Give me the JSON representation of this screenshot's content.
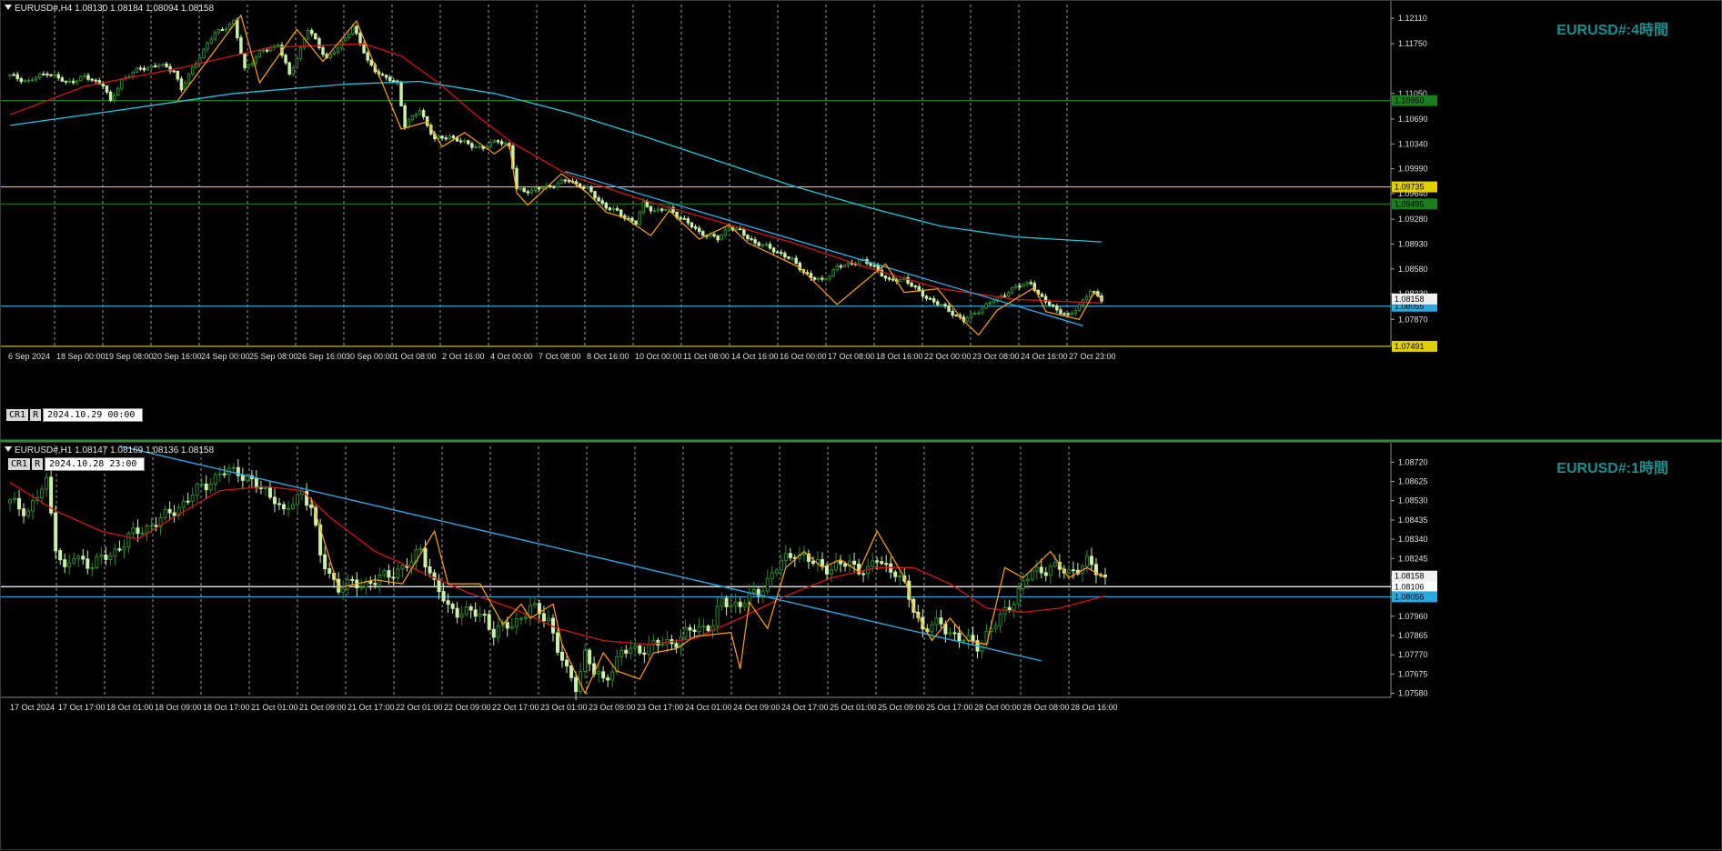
{
  "panel_h4": {
    "info": "EURUSD#,H4  1.08130 1.08184 1.08094 1.08158",
    "watermark": "EURUSD#:4時間",
    "tag1": "CR1",
    "tag2": "R",
    "timestamp": "2024.10.29 00:00"
  },
  "panel_h1": {
    "info": "EURUSD#,H1  1.08147 1.08169 1.08136 1.08158",
    "watermark": "EURUSD#:1時間",
    "tag1": "CR1",
    "tag2": "R",
    "timestamp": "2024.10.28 23:00"
  },
  "colors": {
    "bull": "#2a8a2a",
    "bull_body": "#000000",
    "bear": "#ccf0aa",
    "ma_red": "#d21414",
    "ma_cyan": "#1ec8dc",
    "zigzag": "#ffa500",
    "trend": "#2aa8e0",
    "hline_green": "#1a7f1a",
    "hline_yellow": "#e0d000",
    "hline_cyan": "#2aa8e0",
    "hline_white": "#ffffff",
    "grid": "#9a9a9a",
    "axis_text": "#e0e0e0"
  },
  "chart_data": [
    {
      "type": "candlestick",
      "title": "EURUSD#,H4",
      "ylim": [
        1.0749,
        1.1225
      ],
      "y_ticks": [
        1.1211,
        1.1175,
        1.1105,
        1.1069,
        1.1034,
        1.0999,
        1.0964,
        1.0928,
        1.0893,
        1.0858,
        1.0823,
        1.0787
      ],
      "x_labels": [
        "6 Sep 2024",
        "18 Sep 00:00",
        "19 Sep 08:00",
        "20 Sep 16:00",
        "24 Sep 00:00",
        "25 Sep 08:00",
        "26 Sep 16:00",
        "30 Sep 00:00",
        "1 Oct 08:00",
        "2 Oct 16:00",
        "4 Oct 00:00",
        "7 Oct 08:00",
        "8 Oct 16:00",
        "10 Oct 00:00",
        "11 Oct 08:00",
        "14 Oct 16:00",
        "16 Oct 00:00",
        "17 Oct 08:00",
        "18 Oct 16:00",
        "22 Oct 00:00",
        "23 Oct 08:00",
        "24 Oct 16:00",
        "27 Oct 23:00"
      ],
      "close_path": [
        [
          0,
          1.113
        ],
        [
          5,
          1.1122
        ],
        [
          10,
          1.1135
        ],
        [
          15,
          1.112
        ],
        [
          20,
          1.1128
        ],
        [
          25,
          1.1118
        ],
        [
          27,
          1.1092
        ],
        [
          30,
          1.1125
        ],
        [
          35,
          1.114
        ],
        [
          40,
          1.1145
        ],
        [
          44,
          1.1138
        ],
        [
          46,
          1.111
        ],
        [
          50,
          1.115
        ],
        [
          55,
          1.119
        ],
        [
          60,
          1.1205
        ],
        [
          63,
          1.114
        ],
        [
          67,
          1.1162
        ],
        [
          72,
          1.1175
        ],
        [
          75,
          1.113
        ],
        [
          80,
          1.1195
        ],
        [
          85,
          1.1155
        ],
        [
          88,
          1.1168
        ],
        [
          92,
          1.12
        ],
        [
          96,
          1.115
        ],
        [
          100,
          1.1128
        ],
        [
          104,
          1.112
        ],
        [
          106,
          1.106
        ],
        [
          110,
          1.1082
        ],
        [
          114,
          1.104
        ],
        [
          118,
          1.1045
        ],
        [
          122,
          1.1035
        ],
        [
          127,
          1.1028
        ],
        [
          131,
          1.104
        ],
        [
          134,
          1.103
        ],
        [
          136,
          1.097
        ],
        [
          140,
          1.0968
        ],
        [
          145,
          1.0975
        ],
        [
          150,
          1.0983
        ],
        [
          155,
          1.097
        ],
        [
          158,
          1.0955
        ],
        [
          160,
          1.0945
        ],
        [
          163,
          1.0938
        ],
        [
          168,
          1.0922
        ],
        [
          170,
          1.095
        ],
        [
          173,
          1.094
        ],
        [
          177,
          1.0942
        ],
        [
          180,
          1.093
        ],
        [
          185,
          1.091
        ],
        [
          190,
          1.09
        ],
        [
          193,
          1.0918
        ],
        [
          196,
          1.091
        ],
        [
          200,
          1.0895
        ],
        [
          205,
          1.0885
        ],
        [
          210,
          1.087
        ],
        [
          215,
          1.0845
        ],
        [
          218,
          1.0842
        ],
        [
          222,
          1.086
        ],
        [
          228,
          1.087
        ],
        [
          232,
          1.0862
        ],
        [
          236,
          1.084
        ],
        [
          240,
          1.0845
        ],
        [
          244,
          1.0825
        ],
        [
          248,
          1.0812
        ],
        [
          252,
          1.08
        ],
        [
          256,
          1.0785
        ],
        [
          260,
          1.08
        ],
        [
          266,
          1.082
        ],
        [
          270,
          1.0832
        ],
        [
          274,
          1.084
        ],
        [
          276,
          1.082
        ],
        [
          280,
          1.0805
        ],
        [
          284,
          1.079
        ],
        [
          287,
          1.0808
        ],
        [
          290,
          1.0826
        ],
        [
          293,
          1.0816
        ]
      ],
      "series": [
        {
          "kind": "ma_red",
          "points": [
            [
              0,
              1.1075
            ],
            [
              20,
              1.1115
            ],
            [
              45,
              1.114
            ],
            [
              70,
              1.117
            ],
            [
              95,
              1.1175
            ],
            [
              105,
              1.1158
            ],
            [
              115,
              1.112
            ],
            [
              125,
              1.1075
            ],
            [
              135,
              1.1035
            ],
            [
              150,
              1.099
            ],
            [
              170,
              1.0955
            ],
            [
              190,
              1.0925
            ],
            [
              210,
              1.0895
            ],
            [
              230,
              1.086
            ],
            [
              250,
              1.083
            ],
            [
              270,
              1.0815
            ],
            [
              293,
              1.081
            ]
          ]
        },
        {
          "kind": "ma_cyan",
          "points": [
            [
              0,
              1.106
            ],
            [
              30,
              1.1082
            ],
            [
              60,
              1.1105
            ],
            [
              90,
              1.1118
            ],
            [
              110,
              1.1122
            ],
            [
              130,
              1.1105
            ],
            [
              150,
              1.1078
            ],
            [
              170,
              1.1045
            ],
            [
              190,
              1.101
            ],
            [
              210,
              1.0975
            ],
            [
              230,
              1.0945
            ],
            [
              250,
              1.0918
            ],
            [
              270,
              1.0903
            ],
            [
              293,
              1.0896
            ]
          ]
        },
        {
          "kind": "trend",
          "points": [
            [
              149,
              1.0995
            ],
            [
              288,
              1.0778
            ]
          ]
        }
      ],
      "zigzag": [
        [
          45,
          1.1095
        ],
        [
          62,
          1.1215
        ],
        [
          67,
          1.112
        ],
        [
          77,
          1.1195
        ],
        [
          84,
          1.115
        ],
        [
          93,
          1.1207
        ],
        [
          105,
          1.1055
        ],
        [
          112,
          1.1065
        ],
        [
          116,
          1.103
        ],
        [
          122,
          1.105
        ],
        [
          130,
          1.102
        ],
        [
          134,
          1.1035
        ],
        [
          136,
          1.0965
        ],
        [
          139,
          1.0948
        ],
        [
          148,
          1.0992
        ],
        [
          155,
          1.0965
        ],
        [
          160,
          1.0938
        ],
        [
          165,
          1.093
        ],
        [
          172,
          1.0905
        ],
        [
          177,
          1.094
        ],
        [
          185,
          1.09
        ],
        [
          193,
          1.092
        ],
        [
          198,
          1.0895
        ],
        [
          212,
          1.086
        ],
        [
          222,
          1.0808
        ],
        [
          235,
          1.0865
        ],
        [
          240,
          1.0825
        ],
        [
          249,
          1.083
        ],
        [
          256,
          1.0785
        ],
        [
          260,
          1.0765
        ],
        [
          265,
          1.08
        ],
        [
          275,
          1.0832
        ],
        [
          278,
          1.0798
        ],
        [
          287,
          1.0787
        ],
        [
          291,
          1.0825
        ],
        [
          293,
          1.0816
        ]
      ],
      "hlines": [
        {
          "price": 1.1095,
          "label": "1.10950",
          "color": "hline_green"
        },
        {
          "price": 1.09735,
          "label": "1.09735",
          "color": "hline_yellow"
        },
        {
          "price": 1.09495,
          "label": "1.09495",
          "color": "hline_green"
        },
        {
          "price": 1.08056,
          "label": "1.08056",
          "color": "hline_cyan"
        },
        {
          "price": 1.07491,
          "label": "1.07491",
          "color": "hline_yellow"
        }
      ],
      "current_price": "1.08158"
    },
    {
      "type": "candlestick",
      "title": "EURUSD#,H1",
      "ylim": [
        1.0756,
        1.0878
      ],
      "y_ticks": [
        1.0872,
        1.08625,
        1.0853,
        1.08435,
        1.0834,
        1.08245,
        1.0815,
        1.08055,
        1.0796,
        1.07865,
        1.0777,
        1.07675,
        1.0758
      ],
      "x_labels": [
        "17 Oct 2024",
        "17 Oct 17:00",
        "18 Oct 01:00",
        "18 Oct 09:00",
        "18 Oct 17:00",
        "21 Oct 01:00",
        "21 Oct 09:00",
        "21 Oct 17:00",
        "22 Oct 01:00",
        "22 Oct 09:00",
        "22 Oct 17:00",
        "23 Oct 01:00",
        "23 Oct 09:00",
        "23 Oct 17:00",
        "24 Oct 01:00",
        "24 Oct 09:00",
        "24 Oct 17:00",
        "25 Oct 01:00",
        "25 Oct 09:00",
        "25 Oct 17:00",
        "28 Oct 00:00",
        "28 Oct 08:00",
        "28 Oct 16:00"
      ],
      "close_path": [
        [
          0,
          1.0852
        ],
        [
          4,
          1.0848
        ],
        [
          8,
          1.0862
        ],
        [
          10,
          1.0832
        ],
        [
          12,
          1.0818
        ],
        [
          14,
          1.0825
        ],
        [
          18,
          1.0822
        ],
        [
          22,
          1.0826
        ],
        [
          26,
          1.0835
        ],
        [
          30,
          1.084
        ],
        [
          34,
          1.0845
        ],
        [
          38,
          1.0852
        ],
        [
          42,
          1.086
        ],
        [
          46,
          1.0866
        ],
        [
          50,
          1.0868
        ],
        [
          54,
          1.086
        ],
        [
          58,
          1.0855
        ],
        [
          60,
          1.0846
        ],
        [
          64,
          1.0858
        ],
        [
          66,
          1.085
        ],
        [
          68,
          1.0825
        ],
        [
          72,
          1.081
        ],
        [
          76,
          1.0812
        ],
        [
          80,
          1.0813
        ],
        [
          84,
          1.0818
        ],
        [
          88,
          1.0822
        ],
        [
          90,
          1.083
        ],
        [
          93,
          1.0812
        ],
        [
          96,
          1.08
        ],
        [
          100,
          1.0798
        ],
        [
          104,
          1.0796
        ],
        [
          106,
          1.0788
        ],
        [
          110,
          1.0792
        ],
        [
          114,
          1.08
        ],
        [
          118,
          1.0795
        ],
        [
          120,
          1.078
        ],
        [
          122,
          1.0768
        ],
        [
          124,
          1.0762
        ],
        [
          126,
          1.0778
        ],
        [
          128,
          1.0768
        ],
        [
          130,
          1.0764
        ],
        [
          134,
          1.0778
        ],
        [
          138,
          1.078
        ],
        [
          142,
          1.0782
        ],
        [
          146,
          1.0784
        ],
        [
          150,
          1.079
        ],
        [
          154,
          1.0792
        ],
        [
          156,
          1.0803
        ],
        [
          160,
          1.0802
        ],
        [
          164,
          1.0808
        ],
        [
          168,
          1.082
        ],
        [
          172,
          1.0828
        ],
        [
          176,
          1.0822
        ],
        [
          180,
          1.082
        ],
        [
          184,
          1.0822
        ],
        [
          188,
          1.0818
        ],
        [
          190,
          1.0824
        ],
        [
          194,
          1.0818
        ],
        [
          196,
          1.081
        ],
        [
          198,
          1.08
        ],
        [
          200,
          1.079
        ],
        [
          204,
          1.0792
        ],
        [
          208,
          1.0785
        ],
        [
          212,
          1.0782
        ],
        [
          216,
          1.0792
        ],
        [
          220,
          1.0805
        ],
        [
          224,
          1.0818
        ],
        [
          228,
          1.082
        ],
        [
          232,
          1.0818
        ],
        [
          236,
          1.0822
        ],
        [
          240,
          1.0815
        ]
      ],
      "series": [
        {
          "kind": "ma_red",
          "points": [
            [
              0,
              1.0862
            ],
            [
              10,
              1.0848
            ],
            [
              20,
              1.0838
            ],
            [
              28,
              1.0834
            ],
            [
              36,
              1.0845
            ],
            [
              46,
              1.0858
            ],
            [
              56,
              1.086
            ],
            [
              64,
              1.0858
            ],
            [
              70,
              1.0845
            ],
            [
              80,
              1.0828
            ],
            [
              90,
              1.0818
            ],
            [
              100,
              1.0808
            ],
            [
              110,
              1.08
            ],
            [
              120,
              1.079
            ],
            [
              130,
              1.0784
            ],
            [
              140,
              1.0782
            ],
            [
              150,
              1.0785
            ],
            [
              160,
              1.0795
            ],
            [
              170,
              1.0806
            ],
            [
              180,
              1.0815
            ],
            [
              190,
              1.082
            ],
            [
              198,
              1.082
            ],
            [
              206,
              1.0812
            ],
            [
              214,
              1.08
            ],
            [
              222,
              1.0798
            ],
            [
              230,
              1.08
            ],
            [
              240,
              1.0806
            ]
          ]
        },
        {
          "kind": "trend",
          "points": [
            [
              24,
              1.088
            ],
            [
              226,
              1.0774
            ]
          ]
        }
      ],
      "zigzag": [
        [
          66,
          1.0854
        ],
        [
          72,
          1.081
        ],
        [
          80,
          1.0814
        ],
        [
          86,
          1.0812
        ],
        [
          93,
          1.0838
        ],
        [
          96,
          1.0812
        ],
        [
          103,
          1.0812
        ],
        [
          108,
          1.0792
        ],
        [
          112,
          1.0802
        ],
        [
          114,
          1.0795
        ],
        [
          119,
          1.0802
        ],
        [
          121,
          1.0782
        ],
        [
          126,
          1.0758
        ],
        [
          130,
          1.0778
        ],
        [
          133,
          1.0769
        ],
        [
          138,
          1.0765
        ],
        [
          141,
          1.0778
        ],
        [
          146,
          1.078
        ],
        [
          150,
          1.0786
        ],
        [
          158,
          1.0788
        ],
        [
          160,
          1.077
        ],
        [
          162,
          1.0803
        ],
        [
          166,
          1.079
        ],
        [
          170,
          1.082
        ],
        [
          174,
          1.0828
        ],
        [
          178,
          1.082
        ],
        [
          182,
          1.0824
        ],
        [
          186,
          1.0818
        ],
        [
          190,
          1.0838
        ],
        [
          196,
          1.0815
        ],
        [
          198,
          1.08
        ],
        [
          202,
          1.0784
        ],
        [
          206,
          1.0795
        ],
        [
          210,
          1.0784
        ],
        [
          214,
          1.0782
        ],
        [
          218,
          1.082
        ],
        [
          222,
          1.0815
        ],
        [
          228,
          1.0828
        ],
        [
          232,
          1.0815
        ],
        [
          236,
          1.082
        ],
        [
          240,
          1.0815
        ]
      ],
      "hlines": [
        {
          "price": 1.08106,
          "label": "1.08106",
          "color": "hline_white"
        },
        {
          "price": 1.08056,
          "label": "1.08056",
          "color": "hline_cyan"
        }
      ],
      "current_price": "1.08158"
    }
  ]
}
